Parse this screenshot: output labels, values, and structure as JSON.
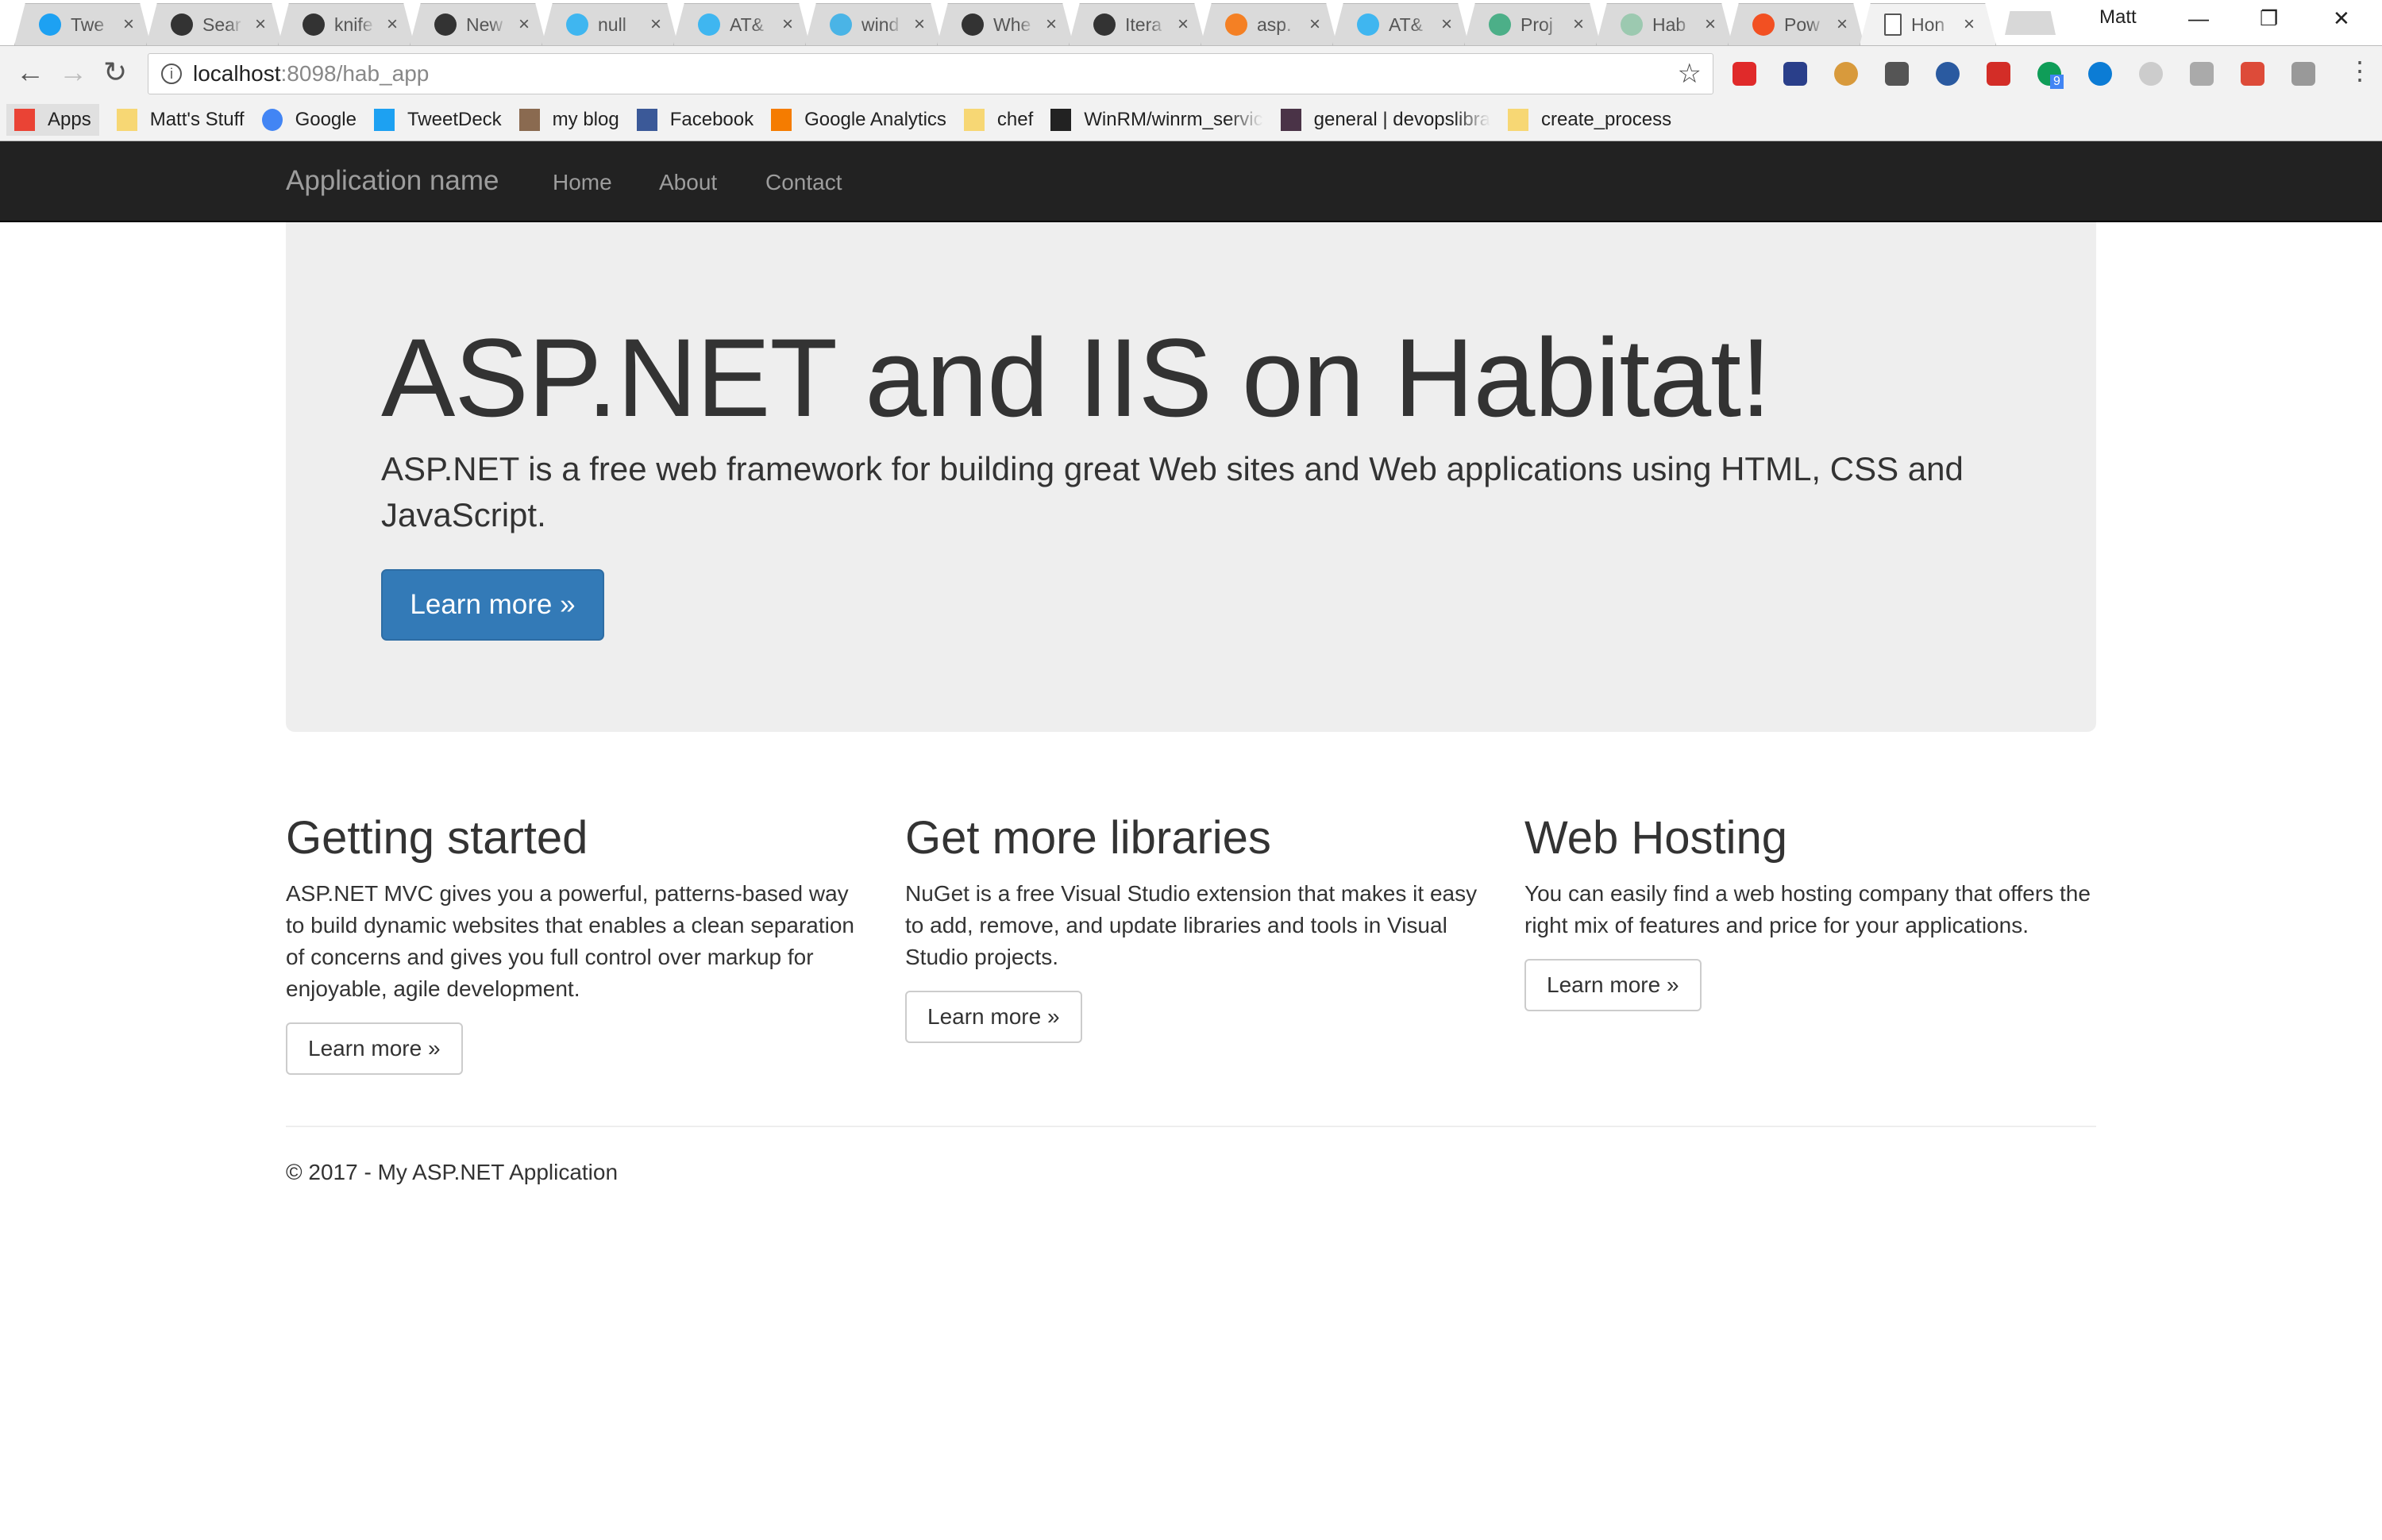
{
  "browser": {
    "tabs": [
      {
        "title": "Twe",
        "icon": "twitter-icon",
        "color": "#1da1f2"
      },
      {
        "title": "Sear",
        "icon": "github-icon",
        "color": "#333333"
      },
      {
        "title": "knife",
        "icon": "github-icon",
        "color": "#333333"
      },
      {
        "title": "New",
        "icon": "github-icon",
        "color": "#333333"
      },
      {
        "title": "null",
        "icon": "att-icon",
        "color": "#3fb6f0"
      },
      {
        "title": "AT&",
        "icon": "att-icon",
        "color": "#3fb6f0"
      },
      {
        "title": "wind",
        "icon": "brackets-icon",
        "color": "#4ab4e6"
      },
      {
        "title": "Whe",
        "icon": "github-icon",
        "color": "#333333"
      },
      {
        "title": "Itera",
        "icon": "github-icon",
        "color": "#333333"
      },
      {
        "title": "asp.",
        "icon": "stackoverflow-icon",
        "color": "#f48024"
      },
      {
        "title": "AT&",
        "icon": "att-icon",
        "color": "#3fb6f0"
      },
      {
        "title": "Proj",
        "icon": "project-icon",
        "color": "#4caf88"
      },
      {
        "title": "Hab",
        "icon": "habitat-icon",
        "color": "#9cc9b0"
      },
      {
        "title": "Pow",
        "icon": "microsoft-icon",
        "color": "#f25022"
      },
      {
        "title": "Hon",
        "icon": "page-icon",
        "color": "#ffffff",
        "active": true
      }
    ],
    "profile": "Matt",
    "address": {
      "host": "localhost",
      "path": ":8098/hab_app"
    },
    "extensions": [
      {
        "icon": "adblock-icon",
        "color": "#e02a2a"
      },
      {
        "icon": "speedometer-icon",
        "color": "#2a3f8a"
      },
      {
        "icon": "cookie-icon",
        "color": "#d89a3c"
      },
      {
        "icon": "dollar-icon",
        "color": "#555555"
      },
      {
        "icon": "globe-icon",
        "color": "#2a5aa0"
      },
      {
        "icon": "lastpass-icon",
        "color": "#d32d27"
      },
      {
        "icon": "hangouts-icon",
        "color": "#0f9d58",
        "badge": "9"
      },
      {
        "icon": "ring-icon",
        "color": "#0c7cd5"
      },
      {
        "icon": "grey-ring-icon",
        "color": "#cccccc"
      },
      {
        "icon": "json-icon",
        "color": "#aaaaaa"
      },
      {
        "icon": "no-flash-icon",
        "color": "#dd4b39"
      },
      {
        "icon": "extension-icon",
        "color": "#999999"
      },
      {
        "icon": "menu-icon",
        "color": "#555555"
      }
    ],
    "bookmarks": [
      {
        "label": "Apps",
        "icon": "apps-icon",
        "color": "#ea4335"
      },
      {
        "label": "Matt's Stuff",
        "icon": "folder-icon",
        "color": "#f7d774"
      },
      {
        "label": "Google",
        "icon": "google-icon",
        "color": "#4285f4"
      },
      {
        "label": "TweetDeck",
        "icon": "tweetdeck-icon",
        "color": "#1da1f2"
      },
      {
        "label": "my blog",
        "icon": "avatar-icon",
        "color": "#8a6a50"
      },
      {
        "label": "Facebook",
        "icon": "facebook-icon",
        "color": "#3b5998"
      },
      {
        "label": "Google Analytics",
        "icon": "analytics-icon",
        "color": "#f57c00"
      },
      {
        "label": "chef",
        "icon": "folder-icon",
        "color": "#f7d774"
      },
      {
        "label": "WinRM/winrm_servic",
        "icon": "github-icon",
        "color": "#222222"
      },
      {
        "label": "general | devopslibra",
        "icon": "slack-icon",
        "color": "#4a3347"
      },
      {
        "label": "create_process",
        "icon": "folder-icon",
        "color": "#f7d774"
      }
    ]
  },
  "navbar": {
    "brand": "Application name",
    "links": [
      "Home",
      "About",
      "Contact"
    ]
  },
  "jumbotron": {
    "title": "ASP.NET and IIS on Habitat!",
    "lead": "ASP.NET is a free web framework for building great Web sites and Web applications using HTML, CSS and JavaScript.",
    "button": "Learn more »"
  },
  "columns": [
    {
      "title": "Getting started",
      "text": "ASP.NET MVC gives you a powerful, patterns-based way to build dynamic websites that enables a clean separation of concerns and gives you full control over markup for enjoyable, agile development.",
      "button": "Learn more »"
    },
    {
      "title": "Get more libraries",
      "text": "NuGet is a free Visual Studio extension that makes it easy to add, remove, and update libraries and tools in Visual Studio projects.",
      "button": "Learn more »"
    },
    {
      "title": "Web Hosting",
      "text": "You can easily find a web hosting company that offers the right mix of features and price for your applications.",
      "button": "Learn more »"
    }
  ],
  "footer": "© 2017 - My ASP.NET Application",
  "colors": {
    "navbar": "#222222",
    "jumbotron": "#eeeeee",
    "primary": "#337ab7"
  }
}
